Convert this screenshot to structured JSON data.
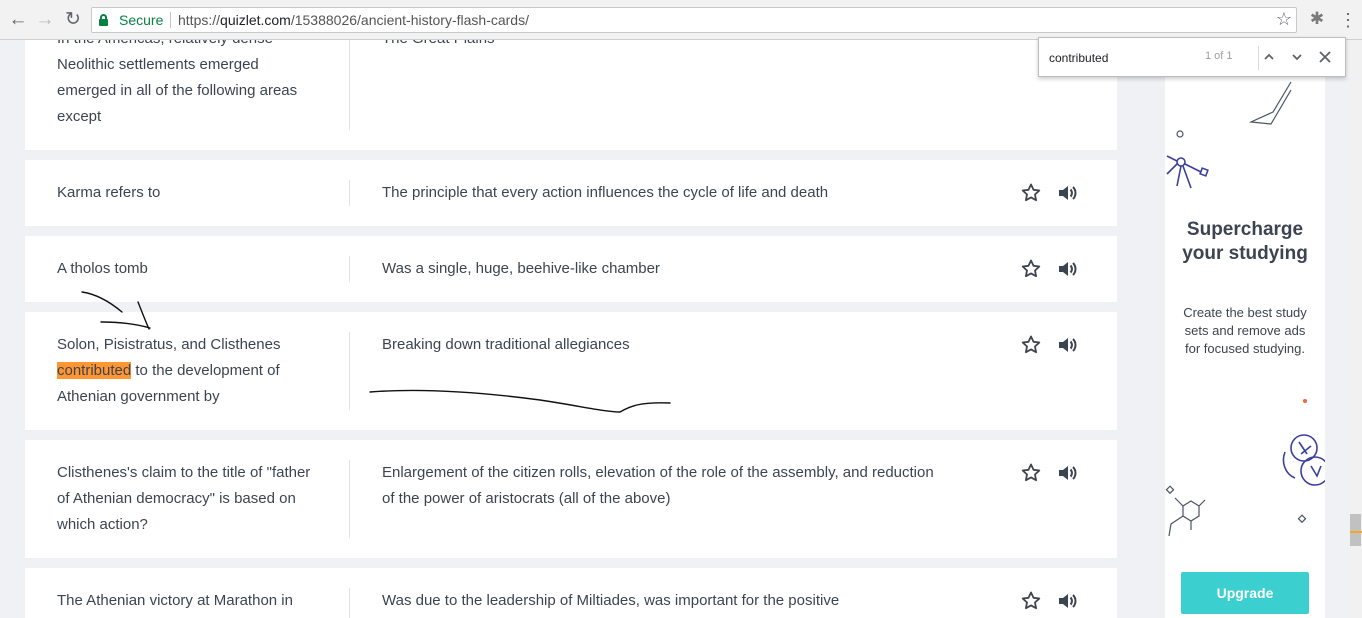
{
  "browser": {
    "back_icon": "arrow-left",
    "forward_icon": "arrow-right",
    "reload_icon": "reload",
    "secure_label": "Secure",
    "url_scheme": "https://",
    "url_host": "quizlet.com",
    "url_path": "/15388026/ancient-history-flash-cards/"
  },
  "find_bar": {
    "query": "contributed",
    "count": "1 of 1"
  },
  "cards": [
    {
      "term": "In the Americas, relatively dense Neolithic settlements emerged emerged in all of the following areas except",
      "definition": "The Great Plains"
    },
    {
      "term": "Karma refers to",
      "definition": "The principle that every action influences the cycle of life and death"
    },
    {
      "term": "A tholos tomb",
      "definition": "Was a single, huge, beehive-like chamber"
    },
    {
      "term_before": "Solon, Pisistratus, and Clisthenes",
      "term_highlight": "contributed",
      "term_after": "to the development of Athenian government by",
      "definition": "Breaking down traditional allegiances"
    },
    {
      "term": "Clisthenes's claim to the title of \"father of Athenian democracy\" is based on which action?",
      "definition": "Enlargement of the citizen rolls, elevation of the role of the assembly, and reduction of the power of aristocrats (all of the above)"
    },
    {
      "term": "The Athenian victory at Marathon in",
      "definition": "Was due to the leadership of Miltiades, was important for the positive"
    }
  ],
  "ad": {
    "title": "Supercharge your studying",
    "body": "Create the best study sets and remove ads for focused studying.",
    "button": "Upgrade"
  },
  "colors": {
    "highlight": "#ff9632",
    "upgrade": "#3ccfcf",
    "secure_green": "#0b8043"
  }
}
